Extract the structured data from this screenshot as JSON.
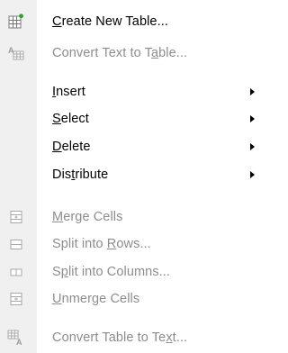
{
  "menu": {
    "items": [
      {
        "id": "create-new-table",
        "label": "Create New Table...",
        "accel_prefix": "",
        "accel": "C",
        "accel_suffix": "reate New Table...",
        "enabled": true,
        "submenu": false,
        "icon": "table-new-icon"
      },
      {
        "id": "convert-text-to-table",
        "label": "Convert Text to Table...",
        "accel_prefix": "Convert Text to T",
        "accel": "a",
        "accel_suffix": "ble...",
        "enabled": false,
        "submenu": false,
        "icon": "text-to-table-icon"
      },
      {
        "id": "insert",
        "label": "Insert",
        "accel_prefix": "",
        "accel": "I",
        "accel_suffix": "nsert",
        "enabled": true,
        "submenu": true,
        "icon": ""
      },
      {
        "id": "select",
        "label": "Select",
        "accel_prefix": "",
        "accel": "S",
        "accel_suffix": "elect",
        "enabled": true,
        "submenu": true,
        "icon": ""
      },
      {
        "id": "delete",
        "label": "Delete",
        "accel_prefix": "",
        "accel": "D",
        "accel_suffix": "elete",
        "enabled": true,
        "submenu": true,
        "icon": ""
      },
      {
        "id": "distribute",
        "label": "Distribute",
        "accel_prefix": "Dis",
        "accel": "t",
        "accel_suffix": "ribute",
        "enabled": true,
        "submenu": true,
        "icon": ""
      },
      {
        "id": "merge-cells",
        "label": "Merge Cells",
        "accel_prefix": "",
        "accel": "M",
        "accel_suffix": "erge Cells",
        "enabled": false,
        "submenu": false,
        "icon": "merge-cells-icon"
      },
      {
        "id": "split-into-rows",
        "label": "Split into Rows...",
        "accel_prefix": "Split into ",
        "accel": "R",
        "accel_suffix": "ows...",
        "enabled": false,
        "submenu": false,
        "icon": "split-rows-icon"
      },
      {
        "id": "split-into-columns",
        "label": "Split into Columns...",
        "accel_prefix": "S",
        "accel": "p",
        "accel_suffix": "lit into Columns...",
        "enabled": false,
        "submenu": false,
        "icon": "split-columns-icon"
      },
      {
        "id": "unmerge-cells",
        "label": "Unmerge Cells",
        "accel_prefix": "",
        "accel": "U",
        "accel_suffix": "nmerge Cells",
        "enabled": false,
        "submenu": false,
        "icon": "unmerge-cells-icon"
      },
      {
        "id": "convert-table-to-text",
        "label": "Convert Table to Text...",
        "accel_prefix": "Convert Table to Te",
        "accel": "x",
        "accel_suffix": "t...",
        "enabled": false,
        "submenu": false,
        "icon": "table-to-text-icon"
      }
    ]
  },
  "colors": {
    "text_enabled": "#000000",
    "text_disabled": "#8d8d8d",
    "gutter": "#f0f0f0",
    "icon_green": "#2e9e2e",
    "icon_gray": "#8a8a8a"
  }
}
